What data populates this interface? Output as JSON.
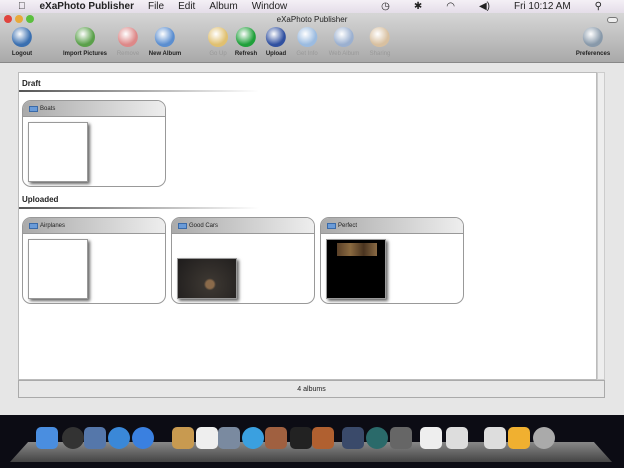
{
  "menubar": {
    "app": "eXaPhoto Publisher",
    "items": [
      "File",
      "Edit",
      "Album",
      "Window"
    ],
    "clock": "Fri 10:12 AM"
  },
  "window": {
    "title": "eXaPhoto Publisher"
  },
  "toolbar": [
    {
      "label": "Logout",
      "icon": "logout-icon",
      "enabled": true,
      "color": "#3a6fb0"
    },
    {
      "label": "Import Pictures",
      "icon": "import-icon",
      "enabled": true,
      "color": "#5aa04a"
    },
    {
      "label": "Remove",
      "icon": "remove-icon",
      "enabled": false,
      "color": "#d88"
    },
    {
      "label": "New Album",
      "icon": "new-album-icon",
      "enabled": true,
      "color": "#5b8ed0"
    },
    {
      "label": "Go Up",
      "icon": "go-up-icon",
      "enabled": false,
      "color": "#e0c070"
    },
    {
      "label": "Refresh",
      "icon": "refresh-icon",
      "enabled": true,
      "color": "#1fa03a"
    },
    {
      "label": "Upload",
      "icon": "upload-icon",
      "enabled": true,
      "color": "#3050a0"
    },
    {
      "label": "Get Info",
      "icon": "info-icon",
      "enabled": false,
      "color": "#9bbbe0"
    },
    {
      "label": "Web Album",
      "icon": "globe-icon",
      "enabled": false,
      "color": "#9bb0d0"
    },
    {
      "label": "Sharing",
      "icon": "sharing-icon",
      "enabled": false,
      "color": "#d8c0a0"
    },
    {
      "label": "Preferences",
      "icon": "preferences-icon",
      "enabled": true,
      "color": "#8899aa"
    }
  ],
  "sections": [
    {
      "title": "Draft",
      "albums": [
        {
          "name": "Boats",
          "thumb": "blank"
        }
      ]
    },
    {
      "title": "Uploaded",
      "albums": [
        {
          "name": "Airplanes",
          "thumb": "blank"
        },
        {
          "name": "Good Cars",
          "thumb": "deer"
        },
        {
          "name": "Perfect",
          "thumb": "dark"
        }
      ]
    }
  ],
  "status": "4 albums"
}
